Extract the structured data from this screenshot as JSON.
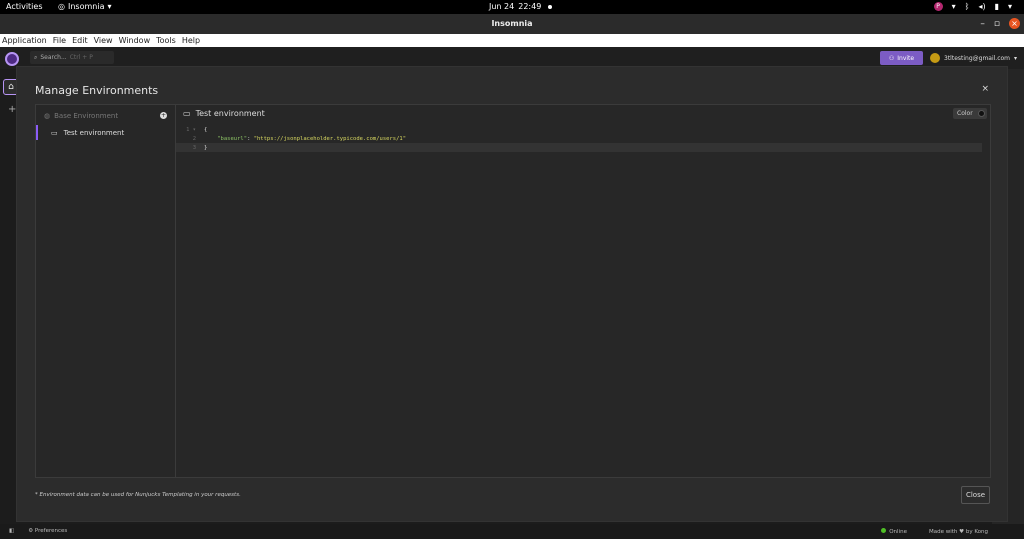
{
  "system_bar": {
    "activities": "Activities",
    "app_name": "Insomnia",
    "date": "Jun 24",
    "time": "22:49",
    "badge_letter": "P"
  },
  "window": {
    "title": "Insomnia"
  },
  "menu": [
    "Application",
    "File",
    "Edit",
    "View",
    "Window",
    "Tools",
    "Help"
  ],
  "header": {
    "search_label": "Search...",
    "search_shortcut": "Ctrl + P",
    "invite_label": "Invite",
    "account_email": "3tltesting@gmail.com"
  },
  "modal": {
    "title": "Manage Environments",
    "close_icon": "×",
    "base_env_label": "Base Environment",
    "add_icon": "+",
    "selected_env_label": "Test environment",
    "editor_title": "Test environment",
    "color_label": "Color",
    "code_lines": [
      {
        "num": "1 ▾",
        "text": "{"
      },
      {
        "num": "2",
        "key": "\"baseurl\"",
        "sep": ": ",
        "value": "\"https://jsonplaceholder.typicode.com/users/1\""
      },
      {
        "num": "3",
        "text": "}"
      }
    ],
    "footnote": "* Environment data can be used for Nunjucks Templating in your requests.",
    "close_button": "Close"
  },
  "status_bar": {
    "preferences": "Preferences",
    "online": "Online",
    "made_with_prefix": "Made with",
    "made_with_suffix": "by Kong",
    "colors": {
      "online": "#4fbf26",
      "accent": "#8b5cf6"
    }
  }
}
